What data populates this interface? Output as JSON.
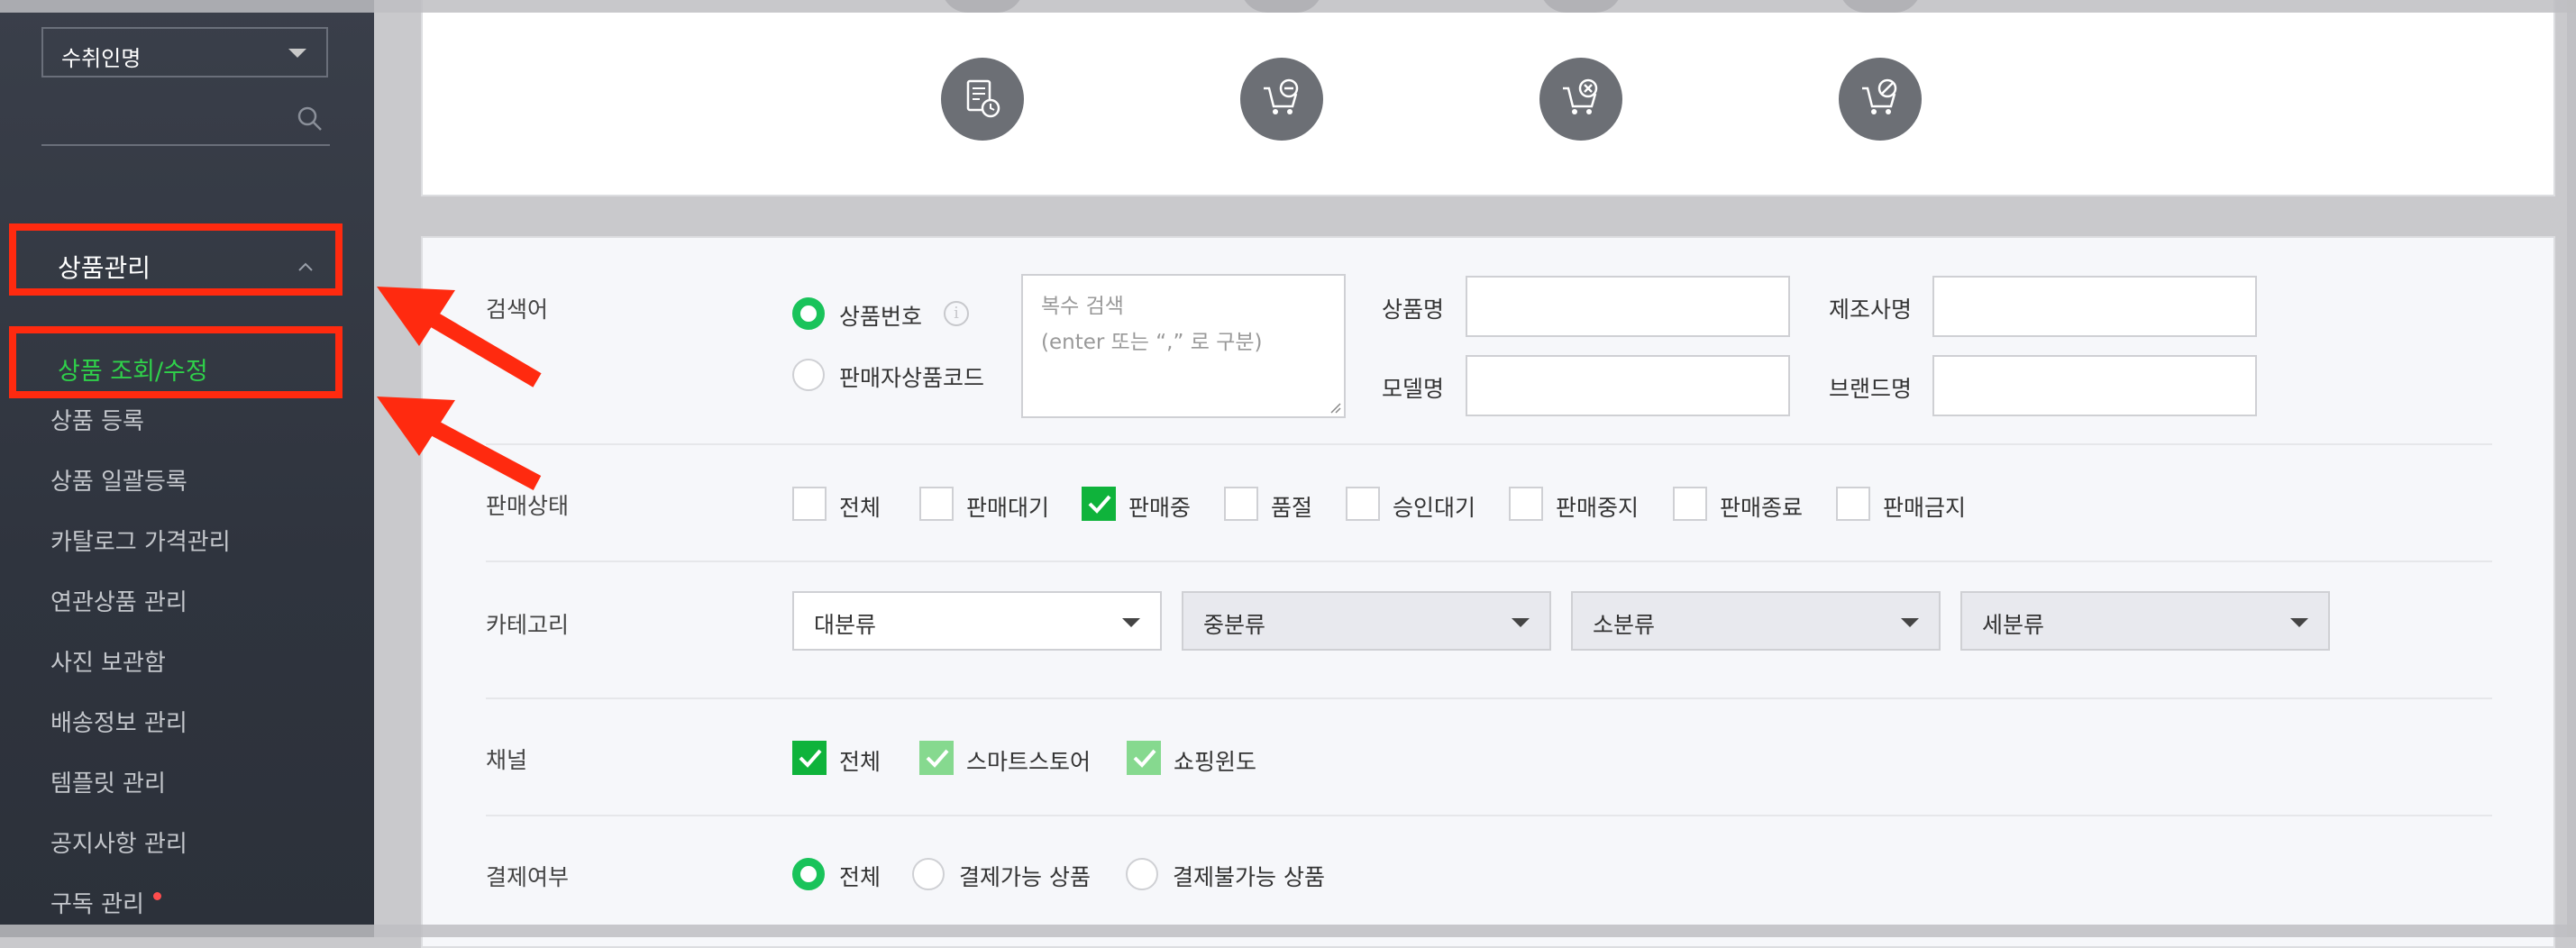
{
  "sidebar": {
    "select_value": "수취인명",
    "menu_section": "상품관리",
    "active_item": "상품 조회/수정",
    "items": [
      "상품 등록",
      "상품 일괄등록",
      "카탈로그 가격관리",
      "연관상품 관리",
      "사진 보관함",
      "배송정보 관리",
      "템플릿 관리",
      "공지사항 관리",
      "구독 관리"
    ]
  },
  "search": {
    "keyword": {
      "label": "검색어",
      "options": [
        "상품번호",
        "판매자상품코드"
      ],
      "selected": "상품번호",
      "textarea_placeholder": "복수 검색\n(enter 또는 “,” 로 구분)",
      "fields": [
        "상품명",
        "제조사명",
        "모델명",
        "브랜드명"
      ]
    },
    "status": {
      "label": "판매상태",
      "options": [
        "전체",
        "판매대기",
        "판매중",
        "품절",
        "승인대기",
        "판매중지",
        "판매종료",
        "판매금지"
      ],
      "checked": [
        "판매중"
      ]
    },
    "category": {
      "label": "카테고리",
      "dropdowns": [
        "대분류",
        "중분류",
        "소분류",
        "세분류"
      ]
    },
    "channel": {
      "label": "채널",
      "options": [
        "전체",
        "스마트스토어",
        "쇼핑윈도"
      ]
    },
    "payment": {
      "label": "결제여부",
      "options": [
        "전체",
        "결제가능 상품",
        "결제불가능 상품"
      ],
      "selected": "전체"
    }
  },
  "colors": {
    "accent": "#19c35a",
    "highlight": "#ff2a0f",
    "sidebar_bg": "#2f343e"
  }
}
